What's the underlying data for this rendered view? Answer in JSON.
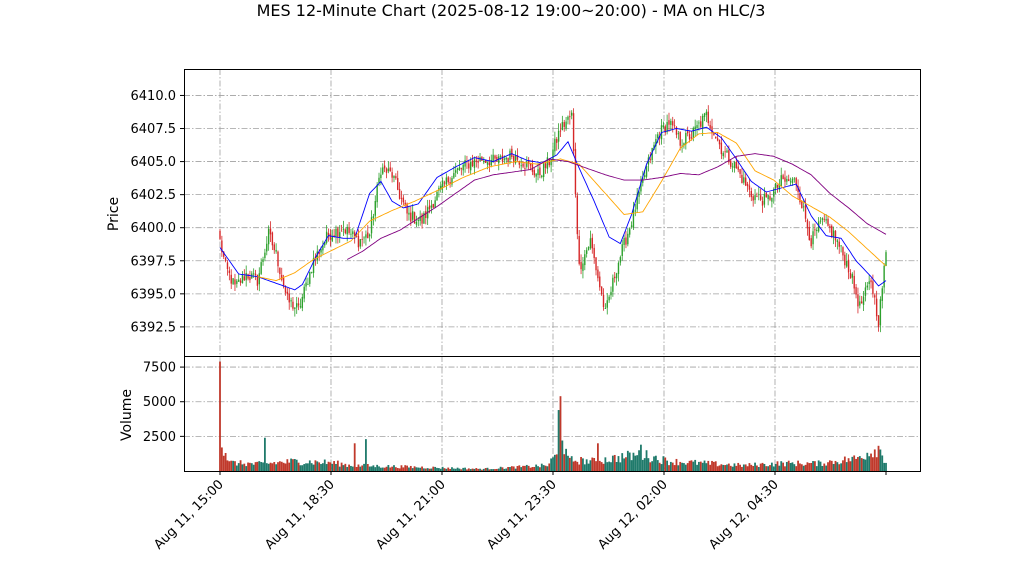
{
  "chart_data": {
    "type": "candlestick",
    "title": "MES 12-Minute Chart (2025-08-12 19:00~20:00) - MA on HLC/3",
    "ylabel": "Price",
    "volume_ylabel": "Volume",
    "x_tick_labels": [
      "Aug 11, 15:00",
      "Aug 11, 18:30",
      "Aug 11, 21:00",
      "Aug 11, 23:30",
      "Aug 12, 02:00",
      "Aug 12, 04:30"
    ],
    "price_ticks": [
      6392.5,
      6395.0,
      6397.5,
      6400.0,
      6402.5,
      6405.0,
      6407.5,
      6410.0
    ],
    "price_tick_labels": [
      "6392.5",
      "6395.0",
      "6397.5",
      "6400.0",
      "6402.5",
      "6405.0",
      "6407.5",
      "6410.0"
    ],
    "ylim": [
      6390.3,
      6412.0
    ],
    "volume_ticks": [
      2500,
      5000,
      7500
    ],
    "volume_tick_labels": [
      "2500",
      "5000",
      "7500"
    ],
    "volume_ylim": [
      0,
      8300
    ],
    "grid": true,
    "colors": {
      "up": "#2ca02c",
      "down": "#d62728",
      "volume_up": "#1f7a6b",
      "volume_down": "#c0392b",
      "ma_fast": "#0000ff",
      "ma_mid": "#ffa500",
      "ma_slow": "#800080"
    },
    "price_anchor_points": [
      [
        0,
        6399.0
      ],
      [
        3,
        6397.0
      ],
      [
        8,
        6395.5
      ],
      [
        14,
        6396.5
      ],
      [
        20,
        6396.0
      ],
      [
        26,
        6399.5
      ],
      [
        30,
        6398.0
      ],
      [
        36,
        6394.5
      ],
      [
        42,
        6393.8
      ],
      [
        50,
        6397.5
      ],
      [
        58,
        6399.5
      ],
      [
        66,
        6400.0
      ],
      [
        74,
        6399.0
      ],
      [
        80,
        6399.5
      ],
      [
        86,
        6404.5
      ],
      [
        92,
        6404.0
      ],
      [
        100,
        6401.0
      ],
      [
        108,
        6400.5
      ],
      [
        116,
        6402.5
      ],
      [
        124,
        6404.0
      ],
      [
        132,
        6404.8
      ],
      [
        140,
        6405.2
      ],
      [
        148,
        6405.0
      ],
      [
        156,
        6405.5
      ],
      [
        162,
        6405.0
      ],
      [
        170,
        6404.0
      ],
      [
        176,
        6405.0
      ],
      [
        182,
        6407.5
      ],
      [
        188,
        6408.5
      ],
      [
        192,
        6397.0
      ],
      [
        198,
        6399.0
      ],
      [
        206,
        6393.5
      ],
      [
        212,
        6397.0
      ],
      [
        220,
        6400.5
      ],
      [
        228,
        6404.5
      ],
      [
        234,
        6407.0
      ],
      [
        240,
        6408.0
      ],
      [
        246,
        6406.5
      ],
      [
        252,
        6407.0
      ],
      [
        260,
        6408.5
      ],
      [
        268,
        6406.0
      ],
      [
        276,
        6404.5
      ],
      [
        284,
        6402.5
      ],
      [
        292,
        6402.0
      ],
      [
        300,
        6403.5
      ],
      [
        308,
        6403.5
      ],
      [
        316,
        6399.0
      ],
      [
        322,
        6400.5
      ],
      [
        328,
        6399.5
      ],
      [
        336,
        6397.0
      ],
      [
        342,
        6394.0
      ],
      [
        348,
        6396.0
      ],
      [
        352,
        6393.0
      ],
      [
        356,
        6398.0
      ]
    ],
    "volume_anchor_points": [
      [
        0,
        7900
      ],
      [
        1,
        1700
      ],
      [
        2,
        1100
      ],
      [
        3,
        1300
      ],
      [
        5,
        600
      ],
      [
        20,
        500
      ],
      [
        40,
        700
      ],
      [
        60,
        600
      ],
      [
        70,
        400
      ],
      [
        100,
        300
      ],
      [
        140,
        150
      ],
      [
        175,
        400
      ],
      [
        180,
        1200
      ],
      [
        181,
        4400
      ],
      [
        182,
        5400
      ],
      [
        183,
        2200
      ],
      [
        186,
        800
      ],
      [
        200,
        700
      ],
      [
        225,
        1200
      ],
      [
        240,
        700
      ],
      [
        280,
        400
      ],
      [
        300,
        550
      ],
      [
        320,
        550
      ],
      [
        340,
        900
      ],
      [
        352,
        1700
      ],
      [
        356,
        700
      ]
    ],
    "volume_spikes": [
      [
        24,
        2400
      ],
      [
        72,
        2000
      ],
      [
        78,
        2300
      ],
      [
        202,
        2000
      ],
      [
        225,
        1900
      ]
    ],
    "ma_fast_anchor_points": [
      [
        0,
        6398.5
      ],
      [
        10,
        6396.5
      ],
      [
        20,
        6396.3
      ],
      [
        30,
        6395.8
      ],
      [
        40,
        6395.3
      ],
      [
        44,
        6395.7
      ],
      [
        52,
        6398.0
      ],
      [
        58,
        6399.4
      ],
      [
        66,
        6399.2
      ],
      [
        72,
        6399.2
      ],
      [
        80,
        6402.6
      ],
      [
        86,
        6403.5
      ],
      [
        92,
        6402.0
      ],
      [
        98,
        6401.5
      ],
      [
        106,
        6401.8
      ],
      [
        116,
        6403.8
      ],
      [
        126,
        6404.6
      ],
      [
        136,
        6405.3
      ],
      [
        146,
        6405.0
      ],
      [
        156,
        6405.6
      ],
      [
        164,
        6405.1
      ],
      [
        172,
        6404.9
      ],
      [
        180,
        6405.5
      ],
      [
        186,
        6406.5
      ],
      [
        192,
        6404.5
      ],
      [
        200,
        6402.0
      ],
      [
        208,
        6399.3
      ],
      [
        214,
        6398.8
      ],
      [
        220,
        6401.0
      ],
      [
        228,
        6404.8
      ],
      [
        236,
        6407.2
      ],
      [
        244,
        6407.5
      ],
      [
        252,
        6407.3
      ],
      [
        260,
        6407.6
      ],
      [
        268,
        6406.8
      ],
      [
        276,
        6405.2
      ],
      [
        284,
        6403.5
      ],
      [
        292,
        6402.7
      ],
      [
        300,
        6403.0
      ],
      [
        308,
        6403.3
      ],
      [
        316,
        6400.9
      ],
      [
        324,
        6399.4
      ],
      [
        332,
        6399.2
      ],
      [
        340,
        6397.5
      ],
      [
        348,
        6396.3
      ],
      [
        352,
        6395.6
      ],
      [
        356,
        6396.0
      ]
    ],
    "ma_mid_anchor_points": [
      [
        20,
        6396.3
      ],
      [
        30,
        6396.0
      ],
      [
        40,
        6396.6
      ],
      [
        50,
        6397.6
      ],
      [
        60,
        6398.3
      ],
      [
        70,
        6399.0
      ],
      [
        80,
        6400.5
      ],
      [
        92,
        6401.3
      ],
      [
        104,
        6402.0
      ],
      [
        116,
        6402.8
      ],
      [
        130,
        6403.8
      ],
      [
        144,
        6404.6
      ],
      [
        158,
        6405.0
      ],
      [
        170,
        6404.8
      ],
      [
        182,
        6405.2
      ],
      [
        192,
        6404.8
      ],
      [
        204,
        6402.9
      ],
      [
        216,
        6401.0
      ],
      [
        226,
        6401.2
      ],
      [
        236,
        6403.5
      ],
      [
        246,
        6406.0
      ],
      [
        256,
        6407.1
      ],
      [
        266,
        6407.2
      ],
      [
        276,
        6406.4
      ],
      [
        286,
        6404.3
      ],
      [
        296,
        6403.6
      ],
      [
        306,
        6402.4
      ],
      [
        316,
        6401.6
      ],
      [
        326,
        6400.8
      ],
      [
        336,
        6399.7
      ],
      [
        346,
        6398.4
      ],
      [
        356,
        6397.1
      ]
    ],
    "ma_slow_anchor_points": [
      [
        68,
        6397.6
      ],
      [
        76,
        6398.2
      ],
      [
        86,
        6399.2
      ],
      [
        96,
        6399.8
      ],
      [
        106,
        6400.7
      ],
      [
        116,
        6401.6
      ],
      [
        126,
        6402.6
      ],
      [
        136,
        6403.6
      ],
      [
        146,
        6404.0
      ],
      [
        156,
        6404.2
      ],
      [
        166,
        6404.4
      ],
      [
        176,
        6405.2
      ],
      [
        186,
        6405.0
      ],
      [
        196,
        6404.5
      ],
      [
        206,
        6404.0
      ],
      [
        216,
        6403.6
      ],
      [
        226,
        6403.6
      ],
      [
        236,
        6403.8
      ],
      [
        246,
        6404.1
      ],
      [
        256,
        6404.0
      ],
      [
        266,
        6404.6
      ],
      [
        276,
        6405.4
      ],
      [
        286,
        6405.6
      ],
      [
        296,
        6405.4
      ],
      [
        306,
        6404.8
      ],
      [
        316,
        6404.0
      ],
      [
        326,
        6402.6
      ],
      [
        336,
        6401.5
      ],
      [
        346,
        6400.3
      ],
      [
        356,
        6399.5
      ]
    ]
  }
}
